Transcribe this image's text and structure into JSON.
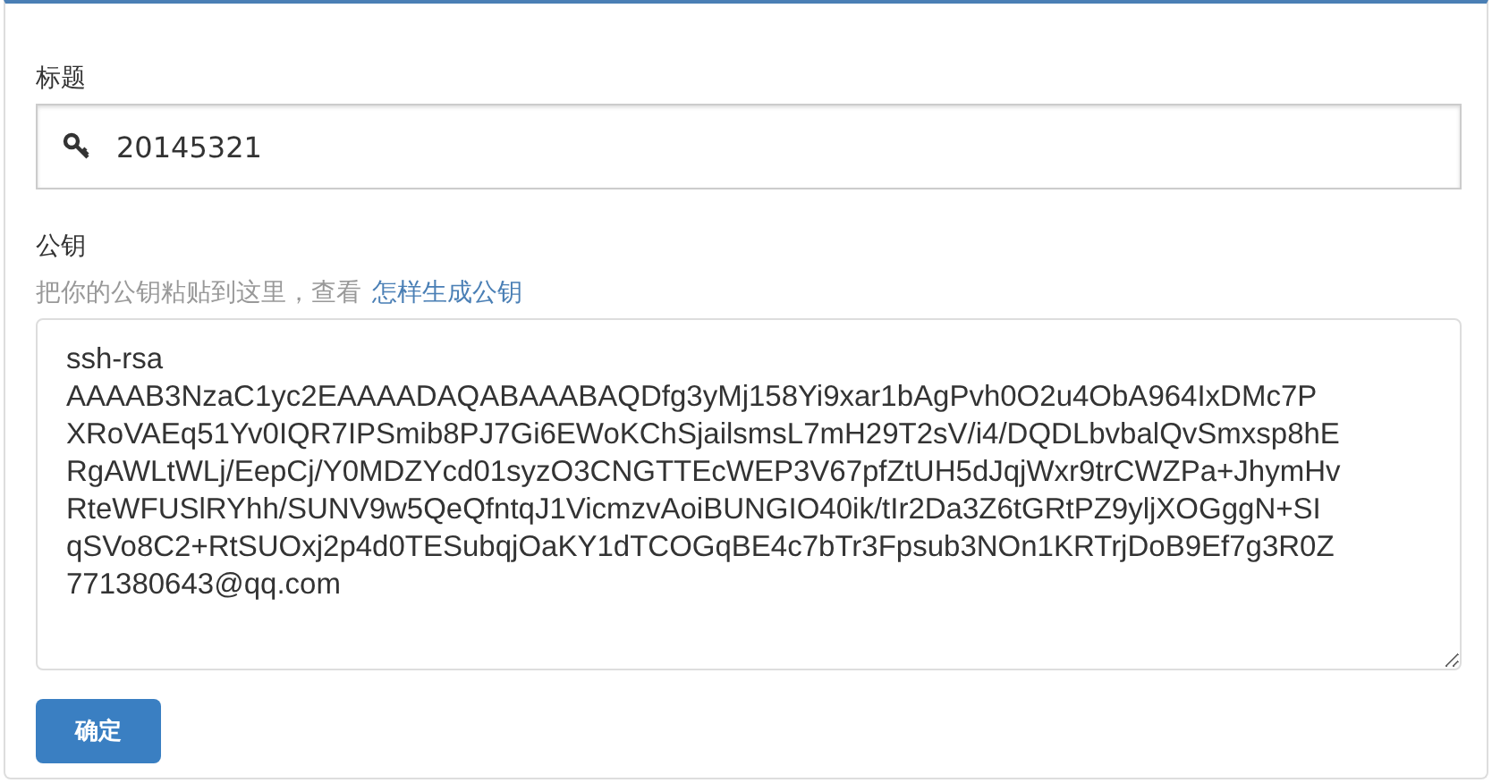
{
  "title_field": {
    "label": "标题",
    "value": "20145321"
  },
  "key_field": {
    "label": "公钥",
    "hint": "把你的公钥粘贴到这里，查看",
    "hint_link": "怎样生成公钥",
    "value_lines": [
      "ssh-rsa",
      "AAAAB3NzaC1yc2EAAAADAQABAAABAQDfg3yMj158Yi9xar1bAgPvh0O2u4ObA964IxDMc7P",
      "XRoVAEq51Yv0IQR7IPSmib8PJ7Gi6EWoKChSjailsmsL7mH29T2sV/i4/DQDLbvbalQvSmxsp8hE",
      "RgAWLtWLj/EepCj/Y0MDZYcd01syzO3CNGTTEcWEP3V67pfZtUH5dJqjWxr9trCWZPa+JhymHv",
      "RteWFUSlRYhh/SUNV9w5QeQfntqJ1VicmzvAoiBUNGIO40ik/tIr2Da3Z6tGRtPZ9yljXOGggN+SI",
      "qSVo8C2+RtSUOxj2p4d0TESubqjOaKY1dTCOGqBE4c7bTr3Fpsub3NOn1KRTrjDoB9Ef7g3R0Z",
      "771380643@qq.com"
    ]
  },
  "submit": "确定"
}
